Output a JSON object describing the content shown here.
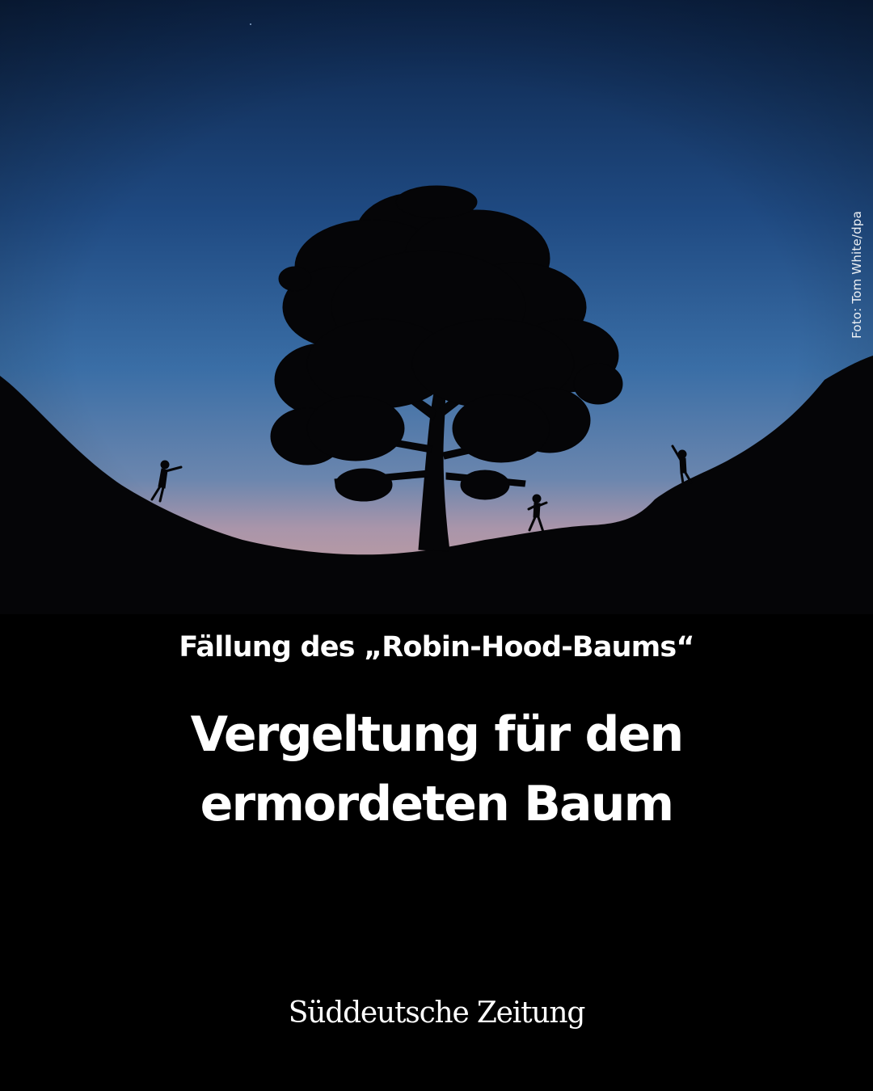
{
  "photo": {
    "credit": "Foto: Tom White/dpa",
    "colors": {
      "sky_top": "#0f2a52",
      "sky_mid": "#3a6da4",
      "horizon_glow": "#b89aa6",
      "silhouette": "#050507"
    }
  },
  "article": {
    "kicker": "Fällung des „Robin-Hood-Baums“",
    "headline": "Vergeltung für den ermordeten Baum"
  },
  "brand": {
    "name": "Süddeutsche Zeitung"
  }
}
